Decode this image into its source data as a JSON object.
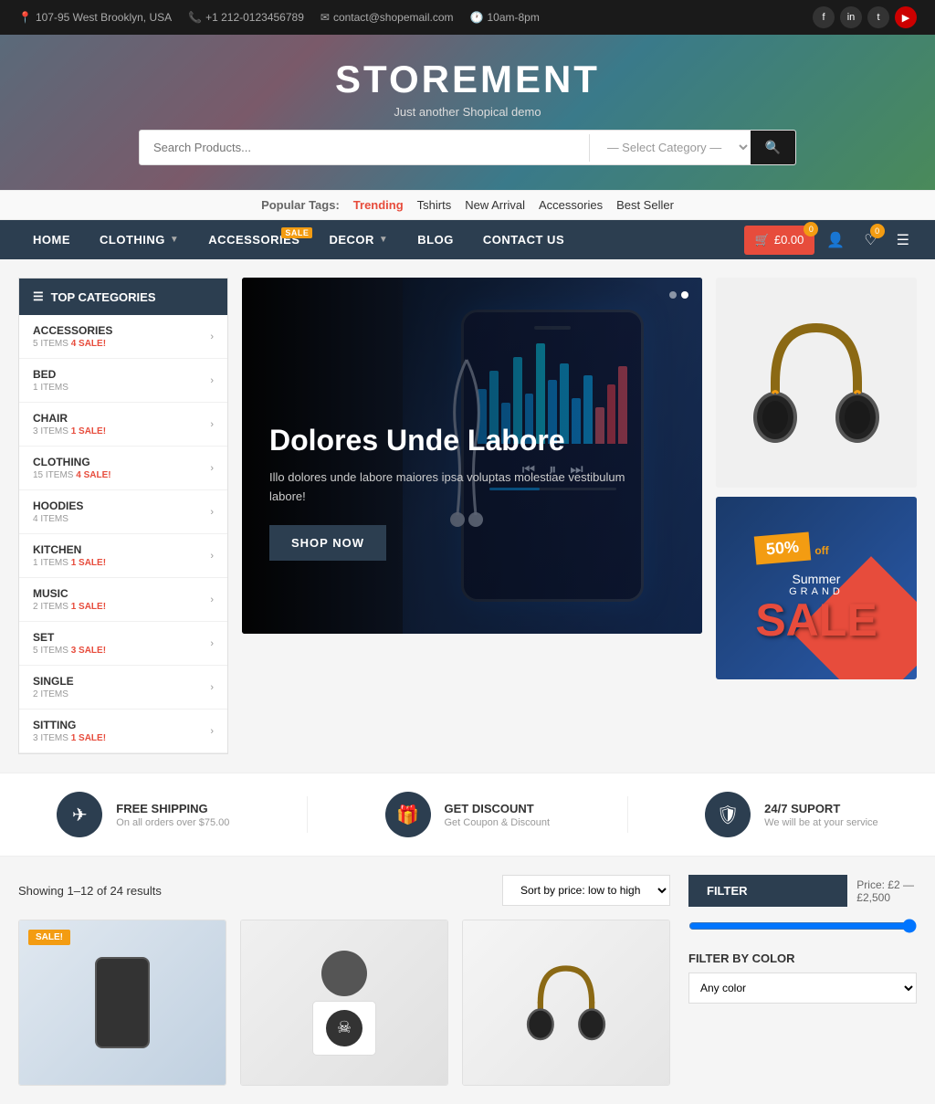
{
  "topbar": {
    "address": "107-95 West Brooklyn, USA",
    "phone": "+1 212-0123456789",
    "email": "contact@shopemail.com",
    "hours": "10am-8pm",
    "social": [
      "f",
      "in",
      "t",
      "yt"
    ]
  },
  "header": {
    "title": "STOREMENT",
    "subtitle": "Just another Shopical demo",
    "search_placeholder": "Search Products...",
    "category_placeholder": "— Select Category —"
  },
  "popular_tags": {
    "label": "Popular Tags:",
    "tags": [
      "Trending",
      "Tshirts",
      "New Arrival",
      "Accessories",
      "Best Seller"
    ]
  },
  "nav": {
    "items": [
      {
        "label": "HOME",
        "sale": false,
        "has_dropdown": false
      },
      {
        "label": "CLOTHING",
        "sale": false,
        "has_dropdown": true
      },
      {
        "label": "ACCESSORIES",
        "sale": true,
        "has_dropdown": false
      },
      {
        "label": "DECOR",
        "sale": false,
        "has_dropdown": true
      },
      {
        "label": "BLOG",
        "sale": false,
        "has_dropdown": false
      },
      {
        "label": "CONTACT US",
        "sale": false,
        "has_dropdown": false
      }
    ],
    "cart_count": "0",
    "cart_total": "£0.00",
    "wish_count": "0"
  },
  "sidebar": {
    "title": "TOP CATEGORIES",
    "categories": [
      {
        "name": "ACCESSORIES",
        "items": "5 ITEMS",
        "sale": "4 SALE!"
      },
      {
        "name": "BED",
        "items": "1 ITEMS",
        "sale": null
      },
      {
        "name": "CHAIR",
        "items": "3 ITEMS",
        "sale": "1 SALE!"
      },
      {
        "name": "CLOTHING",
        "items": "15 ITEMS",
        "sale": "4 SALE!"
      },
      {
        "name": "HOODIES",
        "items": "4 ITEMS",
        "sale": null
      },
      {
        "name": "KITCHEN",
        "items": "1 ITEMS",
        "sale": "1 SALE!"
      },
      {
        "name": "MUSIC",
        "items": "2 ITEMS",
        "sale": "1 SALE!"
      },
      {
        "name": "SET",
        "items": "5 ITEMS",
        "sale": "3 SALE!"
      },
      {
        "name": "SINGLE",
        "items": "2 ITEMS",
        "sale": null
      },
      {
        "name": "SITTING",
        "items": "3 ITEMS",
        "sale": "1 SALE!"
      }
    ]
  },
  "hero": {
    "title": "Dolores Unde Labore",
    "description": "Illo dolores unde labore maiores ipsa voluptas molestiae vestibulum labore!",
    "button": "SHOP NOW",
    "dots": [
      false,
      true
    ]
  },
  "sale_banner": {
    "percent": "50%",
    "off": "off",
    "summer": "Summer",
    "grand": "GRAND",
    "sale": "SALE"
  },
  "features": [
    {
      "icon": "✈",
      "title": "FREE SHIPPING",
      "desc": "On all orders over $75.00"
    },
    {
      "icon": "🎁",
      "title": "GET DISCOUNT",
      "desc": "Get Coupon & Discount"
    },
    {
      "icon": "🛡",
      "title": "24/7 SUPORT",
      "desc": "We will be at your service"
    }
  ],
  "products": {
    "results_text": "Showing 1–12 of 24 results",
    "sort_label": "Sort by price: low to high"
  },
  "filter": {
    "button": "FILTER",
    "price_range": "Price: £2 — £2,500",
    "color_label": "FILTER BY COLOR",
    "color_placeholder": "Any color"
  }
}
